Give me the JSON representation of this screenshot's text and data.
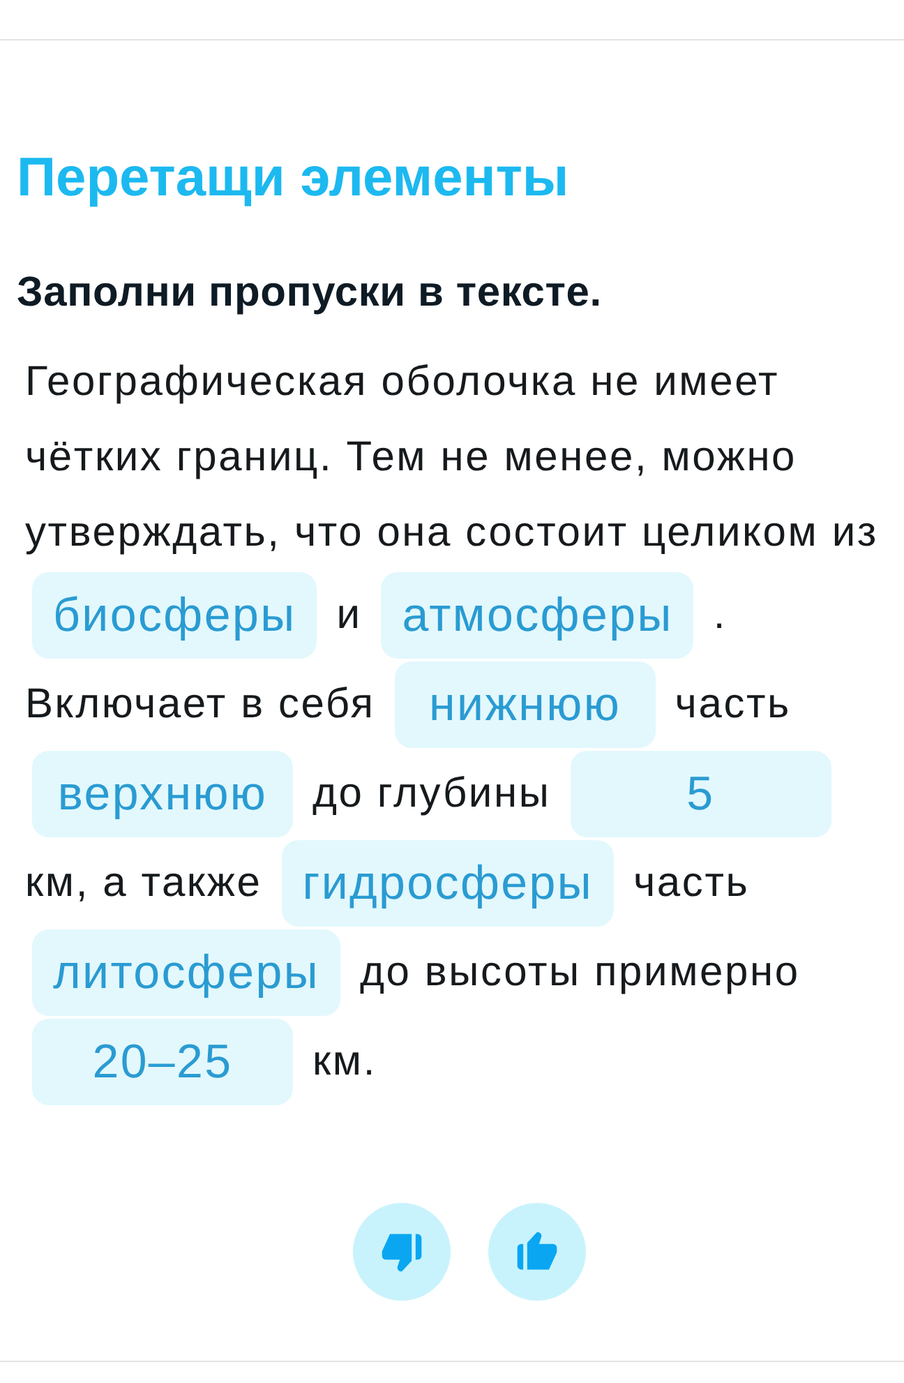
{
  "title": "Перетащи элементы",
  "instruction": "Заполни пропуски в тексте.",
  "lines": [
    [
      {
        "kind": "text",
        "text": "Географическая оболочка не имеет"
      }
    ],
    [
      {
        "kind": "text",
        "text": "чётких границ. Тем не менее, можно"
      }
    ],
    [
      {
        "kind": "text",
        "text": "утверждать, что она состоит целиком из"
      }
    ],
    [
      {
        "kind": "blank",
        "text": "биосферы"
      },
      {
        "kind": "text",
        "text": "и"
      },
      {
        "kind": "blank",
        "text": "атмосферы"
      },
      {
        "kind": "text",
        "text": "."
      }
    ],
    [
      {
        "kind": "text",
        "text": "Включает в себя"
      },
      {
        "kind": "blank",
        "text": "нижнюю"
      },
      {
        "kind": "text",
        "text": "часть"
      }
    ],
    [
      {
        "kind": "blank",
        "text": "верхнюю"
      },
      {
        "kind": "text",
        "text": "до глубины"
      },
      {
        "kind": "blank",
        "text": "5"
      }
    ],
    [
      {
        "kind": "text",
        "text": "км, а также"
      },
      {
        "kind": "blank",
        "text": "гидросферы"
      },
      {
        "kind": "text",
        "text": "часть"
      }
    ],
    [
      {
        "kind": "blank",
        "text": "литосферы"
      },
      {
        "kind": "text",
        "text": "до высоты примерно"
      }
    ],
    [
      {
        "kind": "blank",
        "text": "20–25"
      },
      {
        "kind": "text",
        "text": "км."
      }
    ]
  ]
}
